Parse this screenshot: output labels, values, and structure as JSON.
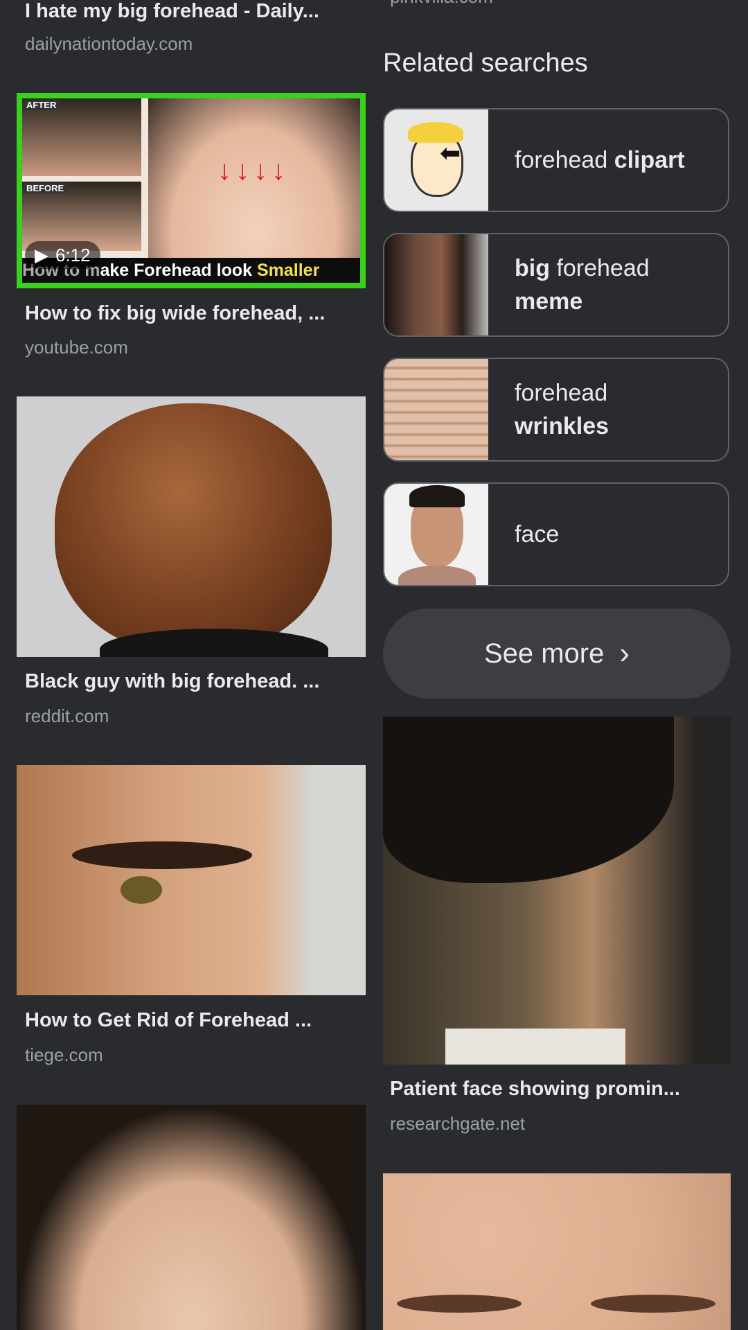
{
  "left": {
    "r0": {
      "title": "I hate my big forehead - Daily...",
      "domain": "dailynationtoday.com"
    },
    "r1": {
      "title": "How to fix big wide forehead, ...",
      "domain": "youtube.com",
      "duration": "6:12",
      "overlay_a": "How to m",
      "overlay_b": "ake Forehead look",
      "overlay_c": "Smaller",
      "after": "AFTER",
      "before": "BEFORE"
    },
    "r2": {
      "title": "Black guy with big forehead. ...",
      "domain": "reddit.com"
    },
    "r3": {
      "title": "How to Get Rid of Forehead ...",
      "domain": "tiege.com"
    }
  },
  "right": {
    "top_domain": "pinkvilla.com",
    "related_heading": "Related searches",
    "related": [
      {
        "a": "forehead",
        "b": "clipart"
      },
      {
        "a": "big",
        "b": "forehead",
        "c": "meme"
      },
      {
        "a": "forehead",
        "b": "wrinkles"
      },
      {
        "a": "face"
      }
    ],
    "see_more": "See more",
    "r1": {
      "title": "Patient face showing promin...",
      "domain": "researchgate.net"
    }
  }
}
